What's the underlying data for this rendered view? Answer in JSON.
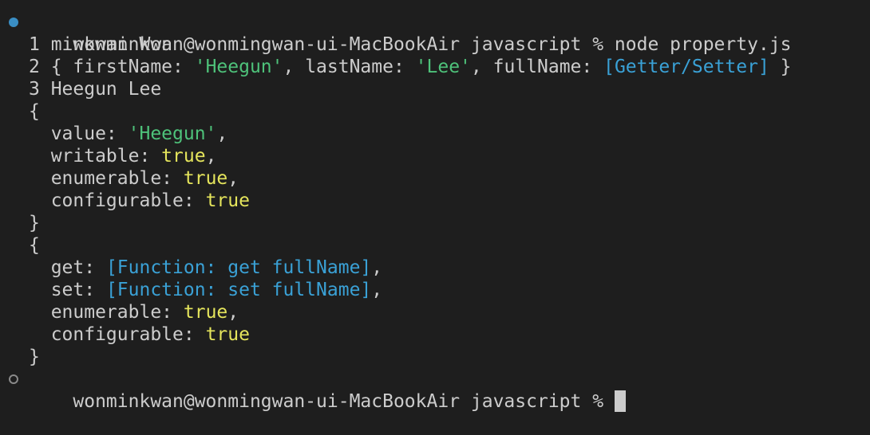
{
  "terminal": {
    "prompt": "wonminkwan@wonmingwan-ui-MacBookAir javascript %",
    "command": "node property.js",
    "colors": {
      "background": "#1e1e1e",
      "foreground": "#cccccc",
      "string": "#4ec27a",
      "keyword": "#e5e55c",
      "function": "#3aa1d6",
      "success_dot": "#3a8ec4"
    },
    "output": {
      "line1": "1 minkwan Won",
      "line2_prefix": "2 { firstName: ",
      "line2_first": "'Heegun'",
      "line2_mid": ", lastName: ",
      "line2_last": "'Lee'",
      "line2_mid2": ", fullName: ",
      "line2_getter": "[Getter/Setter]",
      "line2_suffix": " }",
      "line3": "3 Heegun Lee",
      "open_brace": "{",
      "close_brace": "}",
      "desc1": {
        "value_key": "  value: ",
        "value_val": "'Heegun'",
        "value_sep": ",",
        "writable_key": "  writable: ",
        "writable_val": "true",
        "writable_sep": ",",
        "enumerable_key": "  enumerable: ",
        "enumerable_val": "true",
        "enumerable_sep": ",",
        "configurable_key": "  configurable: ",
        "configurable_val": "true"
      },
      "desc2": {
        "get_key": "  get: ",
        "get_val": "[Function: get fullName]",
        "get_sep": ",",
        "set_key": "  set: ",
        "set_val": "[Function: set fullName]",
        "set_sep": ",",
        "enumerable_key": "  enumerable: ",
        "enumerable_val": "true",
        "enumerable_sep": ",",
        "configurable_key": "  configurable: ",
        "configurable_val": "true"
      }
    }
  }
}
